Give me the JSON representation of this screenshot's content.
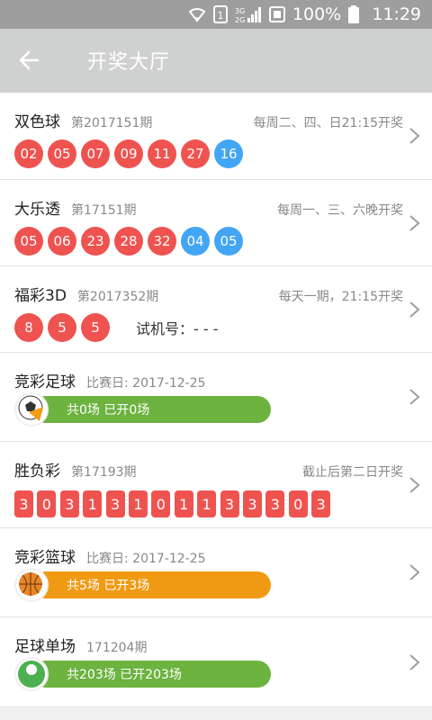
{
  "status": {
    "battery_pct": "100%",
    "time": "11:29",
    "network_label": "3G"
  },
  "header": {
    "title": "开奖大厅",
    "back_icon": "arrow-left-icon"
  },
  "colors": {
    "red": "#ef5350",
    "blue": "#42a5f5",
    "green": "#6cb33f",
    "orange": "#ef9a12"
  },
  "lotteries": [
    {
      "name": "双色球",
      "issue": "第2017151期",
      "schedule": "每周二、四、日21:15开奖",
      "red": [
        "02",
        "05",
        "07",
        "09",
        "11",
        "27"
      ],
      "blue": [
        "16"
      ]
    },
    {
      "name": "大乐透",
      "issue": "第17151期",
      "schedule": "每周一、三、六晚开奖",
      "red": [
        "05",
        "06",
        "23",
        "28",
        "32"
      ],
      "blue": [
        "04",
        "05"
      ]
    },
    {
      "name": "福彩3D",
      "issue": "第2017352期",
      "schedule": "每天一期，21:15开奖",
      "red": [
        "8",
        "5",
        "5"
      ],
      "trial": "试机号：- - -"
    },
    {
      "name": "竞彩足球",
      "date": "比赛日: 2017-12-25",
      "summary": "共0场 已开0场"
    },
    {
      "name": "胜负彩",
      "issue": "第17193期",
      "schedule": "截止后第二日开奖",
      "digits": [
        "3",
        "0",
        "3",
        "1",
        "3",
        "1",
        "0",
        "1",
        "1",
        "3",
        "3",
        "3",
        "0",
        "3"
      ]
    },
    {
      "name": "竞彩篮球",
      "date": "比赛日: 2017-12-25",
      "summary": "共5场 已开3场"
    },
    {
      "name": "足球单场",
      "issue": "171204期",
      "summary": "共203场 已开203场",
      "badge_text": "足球单场"
    }
  ]
}
